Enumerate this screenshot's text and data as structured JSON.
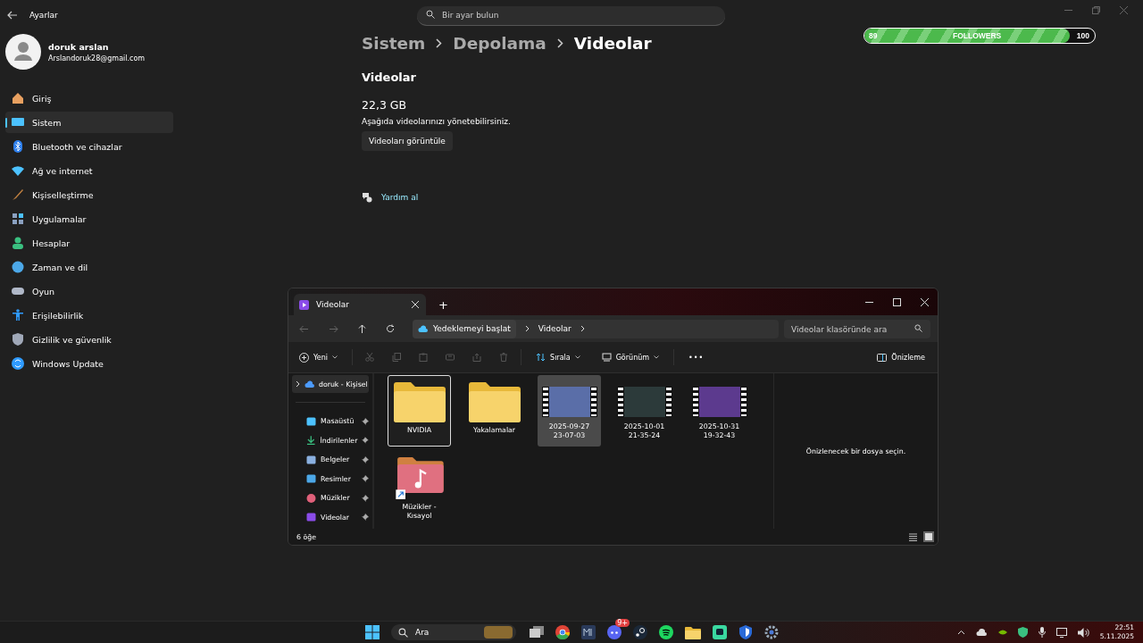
{
  "settings": {
    "title": "Ayarlar",
    "search": {
      "placeholder": "Bir ayar bulun"
    },
    "user": {
      "name": "doruk arslan",
      "email": "Arslandoruk28@gmail.com"
    },
    "nav": [
      {
        "label": "Giriş",
        "selected": false
      },
      {
        "label": "Sistem",
        "selected": true
      },
      {
        "label": "Bluetooth ve cihazlar",
        "selected": false
      },
      {
        "label": "Ağ ve internet",
        "selected": false
      },
      {
        "label": "Kişiselleştirme",
        "selected": false
      },
      {
        "label": "Uygulamalar",
        "selected": false
      },
      {
        "label": "Hesaplar",
        "selected": false
      },
      {
        "label": "Zaman ve dil",
        "selected": false
      },
      {
        "label": "Oyun",
        "selected": false
      },
      {
        "label": "Erişilebilirlik",
        "selected": false
      },
      {
        "label": "Gizlilik ve güvenlik",
        "selected": false
      },
      {
        "label": "Windows Update",
        "selected": false
      }
    ],
    "breadcrumb": [
      "Sistem",
      "Depolama",
      "Videolar"
    ],
    "section_title": "Videolar",
    "size": "22,3 GB",
    "description": "Aşağıda videolarınızı yönetebilirsiniz.",
    "button": "Videoları görüntüle",
    "help": "Yardım al"
  },
  "followers_bar": {
    "start": "89",
    "label": "FOLLOWERS",
    "end": "100",
    "level": 0.89
  },
  "explorer": {
    "tab": "Videolar",
    "new_tab": "+",
    "address": [
      "Yedeklemeyi başlat",
      "Videolar"
    ],
    "search": {
      "placeholder": "Videolar klasöründe ara"
    },
    "toolbar": {
      "new": "Yeni",
      "sort": "Sırala",
      "view": "Görünüm",
      "more": "•••",
      "preview": "Önizleme"
    },
    "sidebar": [
      {
        "label": "doruk - Kişisel",
        "pinned": false,
        "selected": true
      },
      {
        "label": "Masaüstü",
        "pinned": true,
        "selected": false
      },
      {
        "label": "İndirilenler",
        "pinned": true,
        "selected": false
      },
      {
        "label": "Belgeler",
        "pinned": true,
        "selected": false
      },
      {
        "label": "Resimler",
        "pinned": true,
        "selected": false
      },
      {
        "label": "Müzikler",
        "pinned": true,
        "selected": false
      },
      {
        "label": "Videolar",
        "pinned": true,
        "selected": false
      }
    ],
    "items": [
      {
        "kind": "folder",
        "name": [
          "NVIDIA"
        ],
        "selected": true,
        "hovered": false
      },
      {
        "kind": "folder",
        "name": [
          "Yakalamalar"
        ],
        "selected": false,
        "hovered": false
      },
      {
        "kind": "video",
        "name": [
          "2025-09-27",
          "23-07-03"
        ],
        "selected": false,
        "hovered": true,
        "color": "#5a6ea8"
      },
      {
        "kind": "video",
        "name": [
          "2025-10-01",
          "21-35-24"
        ],
        "selected": false,
        "hovered": false,
        "color": "#2c3a3a"
      },
      {
        "kind": "video",
        "name": [
          "2025-10-31",
          "19-32-43"
        ],
        "selected": false,
        "hovered": false,
        "color": "#5c3a8e"
      },
      {
        "kind": "shortcut",
        "name": [
          "Müzikler -",
          "Kısayol"
        ],
        "selected": false,
        "hovered": false
      }
    ],
    "preview_text": "Önizlenecek bir dosya seçin.",
    "status": "6 öğe"
  },
  "taskbar": {
    "search": "Ara",
    "discord_badge": "9+",
    "time": "22:51",
    "date": "5.11.2025"
  }
}
